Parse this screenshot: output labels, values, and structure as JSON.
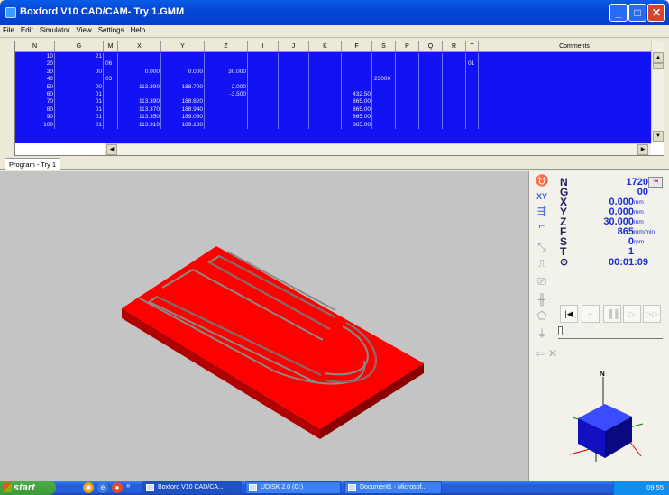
{
  "window": {
    "title": "Boxford V10 CAD/CAM- Try 1.GMM",
    "minimize": "_",
    "maximize": "□",
    "close": "✕"
  },
  "menu": [
    "File",
    "Edit",
    "Simulator",
    "View",
    "Settings",
    "Help"
  ],
  "grid": {
    "columns": [
      "N",
      "G",
      "M",
      "X",
      "Y",
      "Z",
      "I",
      "J",
      "K",
      "F",
      "S",
      "P",
      "Q",
      "R",
      "T",
      "Comments"
    ],
    "rows": [
      {
        "N": "10",
        "G": "21",
        "M": "",
        "X": "",
        "Y": "",
        "Z": "",
        "F": "",
        "S": "",
        "T": ""
      },
      {
        "N": "20",
        "G": "",
        "M": "06",
        "X": "",
        "Y": "",
        "Z": "",
        "F": "",
        "S": "",
        "T": "01"
      },
      {
        "N": "30",
        "G": "00",
        "M": "",
        "X": "0.000",
        "Y": "0.000",
        "Z": "30.000",
        "F": "",
        "S": "",
        "T": ""
      },
      {
        "N": "40",
        "G": "",
        "M": "03",
        "X": "",
        "Y": "",
        "Z": "",
        "F": "",
        "S": "23000",
        "T": ""
      },
      {
        "N": "50",
        "G": "00",
        "M": "",
        "X": "113.390",
        "Y": "188.700",
        "Z": "2.000",
        "F": "",
        "S": "",
        "T": ""
      },
      {
        "N": "60",
        "G": "01",
        "M": "",
        "X": "",
        "Y": "",
        "Z": "-3.500",
        "F": "432.50",
        "S": "",
        "T": ""
      },
      {
        "N": "70",
        "G": "01",
        "M": "",
        "X": "113.390",
        "Y": "188.820",
        "Z": "",
        "F": "865.00",
        "S": "",
        "T": ""
      },
      {
        "N": "80",
        "G": "01",
        "M": "",
        "X": "113.370",
        "Y": "188.940",
        "Z": "",
        "F": "865.00",
        "S": "",
        "T": ""
      },
      {
        "N": "90",
        "G": "01",
        "M": "",
        "X": "113.350",
        "Y": "189.060",
        "Z": "",
        "F": "865.00",
        "S": "",
        "T": ""
      },
      {
        "N": "100",
        "G": "01",
        "M": "",
        "X": "113.310",
        "Y": "189.180",
        "Z": "",
        "F": "865.00",
        "S": "",
        "T": ""
      }
    ]
  },
  "tab": {
    "label": "Program - Try 1"
  },
  "readout": {
    "N": {
      "label": "N",
      "value": "1720"
    },
    "G": {
      "label": "G",
      "value": "00"
    },
    "X": {
      "label": "X",
      "value": "0.000",
      "unit": "mm"
    },
    "Y": {
      "label": "Y",
      "value": "0.000",
      "unit": "mm"
    },
    "Z": {
      "label": "Z",
      "value": "30.000",
      "unit": "mm"
    },
    "F": {
      "label": "F",
      "value": "865",
      "unit": "mm/min"
    },
    "S": {
      "label": "S",
      "value": "0",
      "unit": "rpm"
    },
    "T": {
      "label": "T",
      "value": "1"
    },
    "time": {
      "label": "⊙",
      "value": "00:01:09"
    }
  },
  "toolbar": {
    "xy_label": "XY"
  },
  "viewcube": {
    "north": "N"
  },
  "taskbar": {
    "start": "start",
    "tasks": [
      "Boxford V10 CAD/CA...",
      "UDISK 2.0 (G:)",
      "Document1 - Microsof..."
    ],
    "clock": "09:55",
    "chevron": "»"
  },
  "colors": {
    "grid_bg": "#1212f2",
    "stock": "#e00000",
    "readout": "#1a2ed8"
  }
}
